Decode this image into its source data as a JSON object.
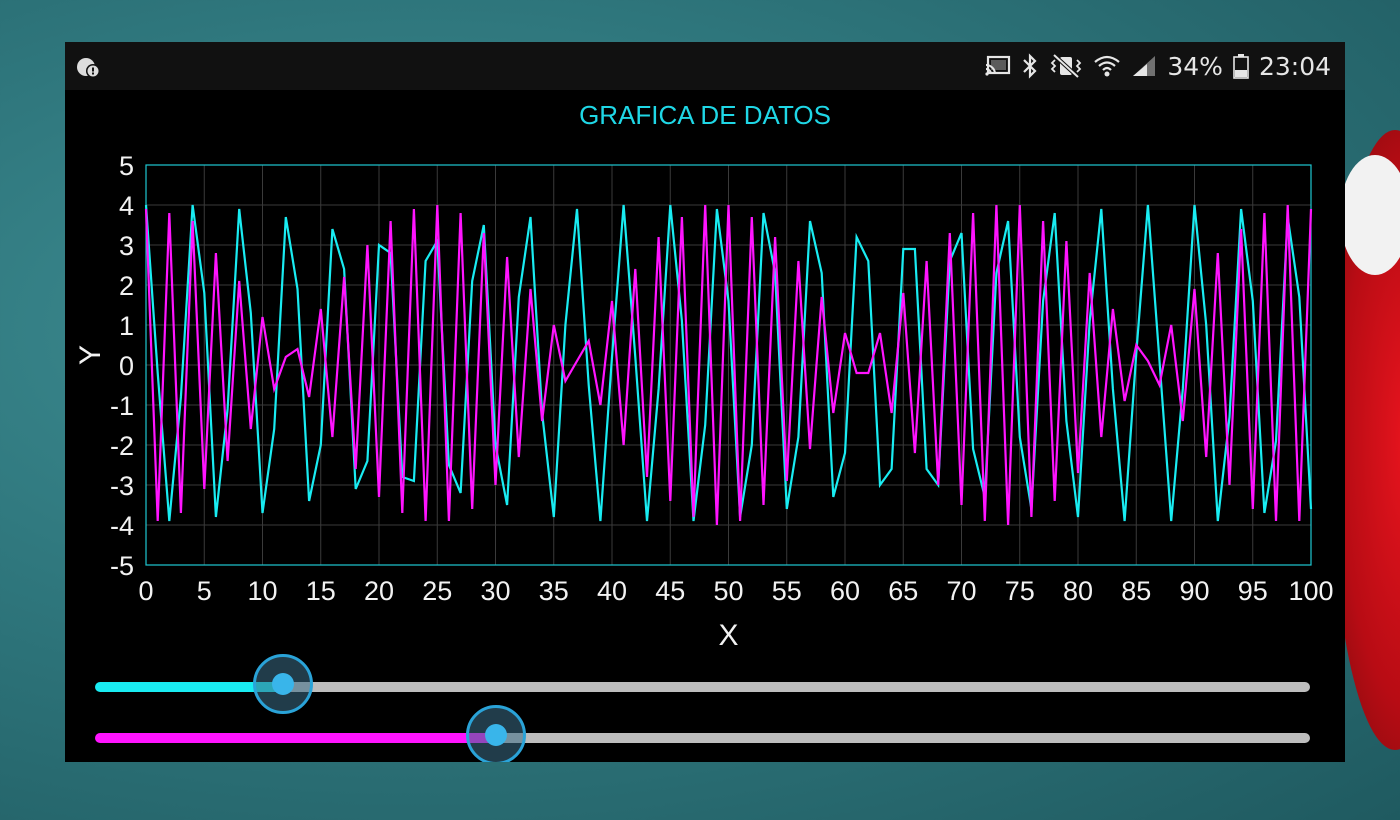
{
  "status_bar": {
    "notification_icon": "alert-badge-icon",
    "icons": [
      "cast-icon",
      "bluetooth-icon",
      "vibrate-mute-icon",
      "wifi-icon",
      "signal-icon"
    ],
    "battery_text": "34%",
    "time": "23:04"
  },
  "app": {
    "title": "GRAFICA DE DATOS"
  },
  "chart_data": {
    "type": "line",
    "xlabel": "X",
    "ylabel": "Y",
    "xlim": [
      0,
      100
    ],
    "ylim": [
      -5,
      5
    ],
    "x_ticks": [
      0,
      5,
      10,
      15,
      20,
      25,
      30,
      35,
      40,
      45,
      50,
      55,
      60,
      65,
      70,
      75,
      80,
      85,
      90,
      95,
      100
    ],
    "y_ticks": [
      5,
      4,
      3,
      2,
      1,
      0,
      -1,
      -2,
      -3,
      -4,
      -5
    ],
    "grid": true,
    "x": [
      0,
      1,
      2,
      3,
      4,
      5,
      6,
      7,
      8,
      9,
      10,
      11,
      12,
      13,
      14,
      15,
      16,
      17,
      18,
      19,
      20,
      21,
      22,
      23,
      24,
      25,
      26,
      27,
      28,
      29,
      30,
      31,
      32,
      33,
      34,
      35,
      36,
      37,
      38,
      39,
      40,
      41,
      42,
      43,
      44,
      45,
      46,
      47,
      48,
      49,
      50,
      51,
      52,
      53,
      54,
      55,
      56,
      57,
      58,
      59,
      60,
      61,
      62,
      63,
      64,
      65,
      66,
      67,
      68,
      69,
      70,
      71,
      72,
      73,
      74,
      75,
      76,
      77,
      78,
      79,
      80,
      81,
      82,
      83,
      84,
      85,
      86,
      87,
      88,
      89,
      90,
      91,
      92,
      93,
      94,
      95,
      96,
      97,
      98,
      99,
      100
    ],
    "series": [
      {
        "color": "#19ecf2",
        "values": [
          4.0,
          -0.2,
          -3.9,
          -0.8,
          4.0,
          1.8,
          -3.8,
          -1.1,
          3.9,
          1.3,
          -3.7,
          -1.6,
          3.7,
          1.9,
          -3.4,
          -2.0,
          3.4,
          2.4,
          -3.1,
          -2.4,
          3.0,
          2.8,
          -2.8,
          -2.9,
          2.6,
          3.1,
          -2.5,
          -3.2,
          2.1,
          3.5,
          -2.0,
          -3.5,
          1.7,
          3.7,
          -1.2,
          -3.8,
          1.0,
          3.9,
          -0.5,
          -3.9,
          0.2,
          4.0,
          0.2,
          -3.9,
          -0.6,
          4.0,
          1.1,
          -3.9,
          -1.5,
          3.9,
          1.6,
          -3.8,
          -2.0,
          3.8,
          2.3,
          -3.6,
          -1.8,
          3.6,
          2.3,
          -3.3,
          -2.2,
          3.2,
          2.6,
          -3.0,
          -2.6,
          2.9,
          2.9,
          -2.6,
          -3.0,
          2.6,
          3.3,
          -2.1,
          -3.3,
          2.3,
          3.6,
          -1.8,
          -3.6,
          1.6,
          3.8,
          -1.4,
          -3.8,
          1.1,
          3.9,
          -0.6,
          -3.9,
          0.3,
          4.0,
          0.1,
          -3.9,
          -0.6,
          4.0,
          1.0,
          -3.9,
          -1.3,
          3.9,
          1.6,
          -3.7,
          -1.9,
          3.7,
          1.7,
          -3.6
        ]
      },
      {
        "color": "#ff14ff",
        "values": [
          3.9,
          -3.9,
          3.8,
          -3.7,
          3.6,
          -3.1,
          2.8,
          -2.4,
          2.1,
          -1.6,
          1.2,
          -0.6,
          0.2,
          0.4,
          -0.8,
          1.4,
          -1.8,
          2.2,
          -2.6,
          3.0,
          -3.3,
          3.6,
          -3.7,
          3.9,
          -3.9,
          4.0,
          -3.9,
          3.8,
          -3.6,
          3.3,
          -3.0,
          2.7,
          -2.3,
          1.9,
          -1.4,
          1.0,
          -0.4,
          0.1,
          0.6,
          -1.0,
          1.6,
          -2.0,
          2.4,
          -2.8,
          3.2,
          -3.4,
          3.7,
          -3.8,
          4.0,
          -4.0,
          4.0,
          -3.9,
          3.7,
          -3.5,
          3.2,
          -2.9,
          2.6,
          -2.1,
          1.7,
          -1.2,
          0.8,
          -0.2,
          -0.2,
          0.8,
          -1.2,
          1.8,
          -2.2,
          2.6,
          -3.0,
          3.3,
          -3.5,
          3.8,
          -3.9,
          4.0,
          -4.0,
          4.0,
          -3.8,
          3.6,
          -3.4,
          3.1,
          -2.7,
          2.3,
          -1.8,
          1.4,
          -0.9,
          0.5,
          0.1,
          -0.5,
          1.0,
          -1.4,
          1.9,
          -2.3,
          2.8,
          -3.0,
          3.4,
          -3.6,
          3.8,
          -3.9,
          4.0,
          -3.9,
          3.9
        ]
      }
    ]
  },
  "sliders": [
    {
      "color": "#19ecf2",
      "value": 0.155
    },
    {
      "color": "#ff14ff",
      "value": 0.33
    }
  ]
}
